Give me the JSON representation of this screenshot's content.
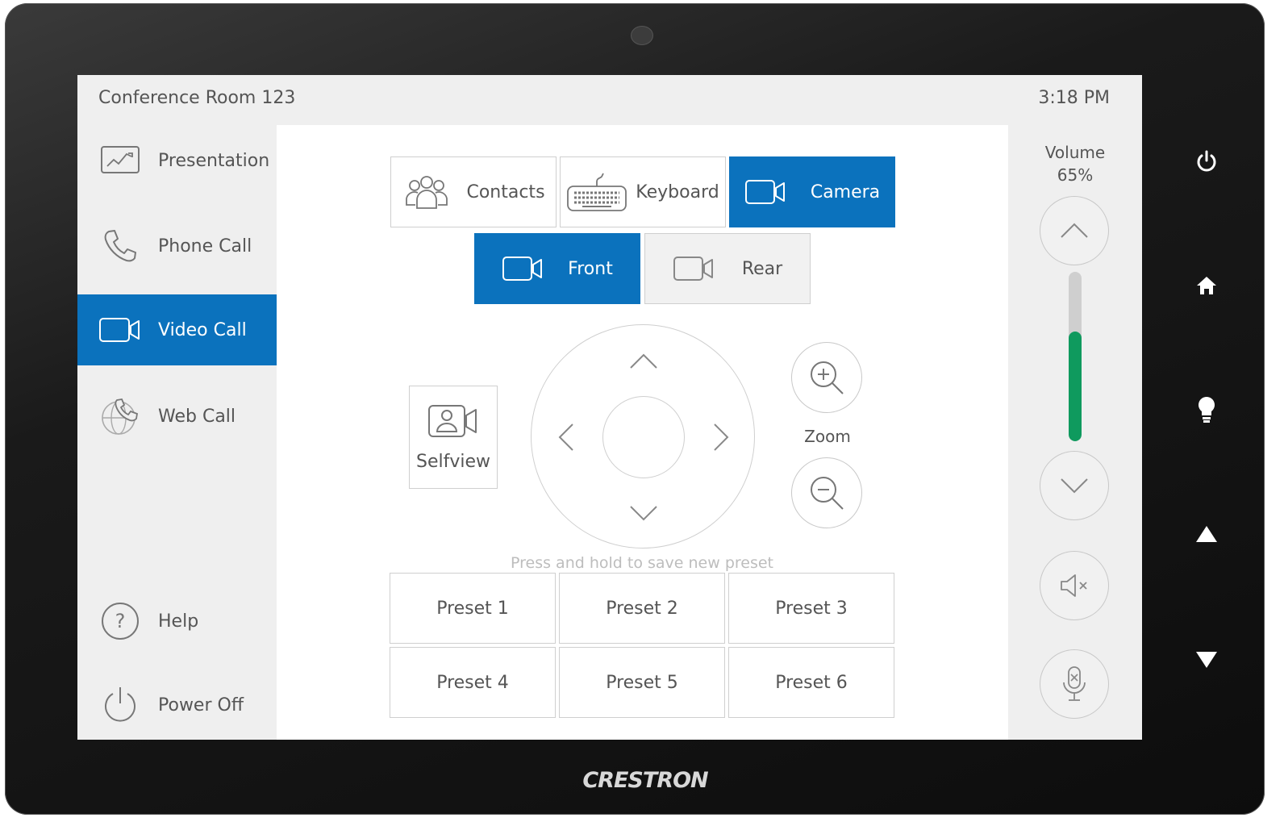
{
  "header": {
    "room_name": "Conference Room 123",
    "time": "3:18 PM"
  },
  "sidebar": {
    "items": [
      {
        "label": "Presentation",
        "icon": "presentation-icon"
      },
      {
        "label": "Phone Call",
        "icon": "phone-icon"
      },
      {
        "label": "Video Call",
        "icon": "video-camera-icon",
        "active": true
      },
      {
        "label": "Web Call",
        "icon": "web-call-icon"
      }
    ],
    "help_label": "Help",
    "power_label": "Power Off"
  },
  "tabs": {
    "contacts": "Contacts",
    "keyboard": "Keyboard",
    "camera": "Camera",
    "active": "Camera"
  },
  "camera_select": {
    "front": "Front",
    "rear": "Rear",
    "active": "Front"
  },
  "selfview_label": "Selfview",
  "zoom_label": "Zoom",
  "preset_hint": "Press and hold to save new preset",
  "presets": [
    "Preset 1",
    "Preset 2",
    "Preset 3",
    "Preset 4",
    "Preset 5",
    "Preset 6"
  ],
  "volume": {
    "label": "Volume",
    "level_text": "65%",
    "level": 0.65
  },
  "brand": "CRESTRON",
  "colors": {
    "accent": "#0b72bd",
    "volume_fill": "#0f9a5e",
    "panel": "#efefef"
  }
}
